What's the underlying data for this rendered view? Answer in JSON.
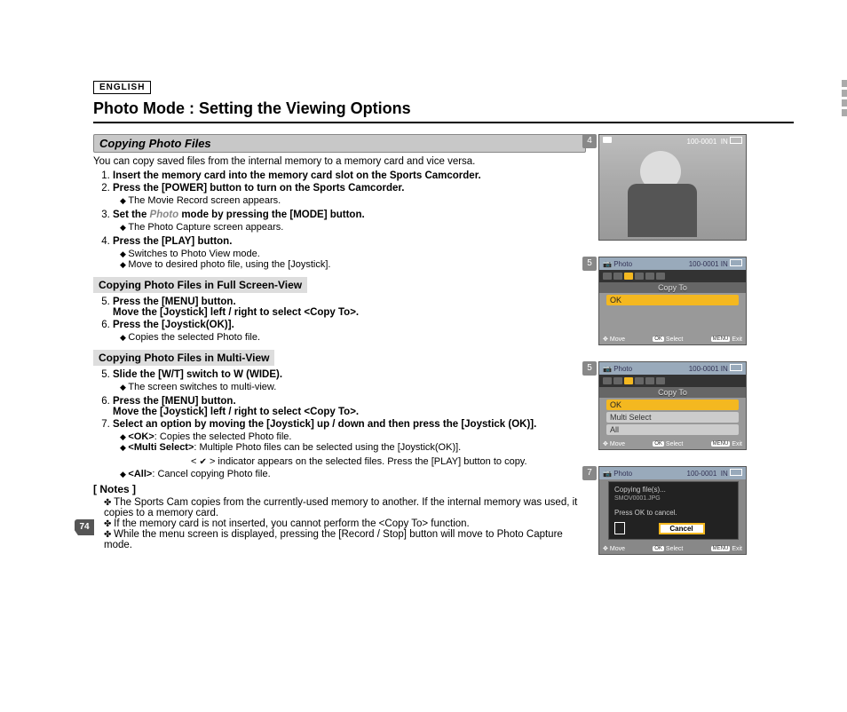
{
  "language": "ENGLISH",
  "page_title": "Photo Mode : Setting the Viewing Options",
  "section_header": "Copying Photo Files",
  "intro": "You can copy saved files from the internal memory to a memory card and vice versa.",
  "steps_a": [
    {
      "title": "Insert the memory card into the memory card slot on the Sports Camcorder."
    },
    {
      "title": "Press the [POWER] button to turn on the Sports Camcorder.",
      "bullets": [
        "The Movie Record screen appears."
      ]
    },
    {
      "title_pre": "Set the ",
      "title_gray": "Photo",
      "title_post": " mode by pressing the [MODE] button.",
      "bullets": [
        "The Photo Capture screen appears."
      ]
    },
    {
      "title": "Press the [PLAY] button.",
      "bullets": [
        "Switches to Photo View mode.",
        "Move to desired photo file, using the [Joystick]."
      ]
    }
  ],
  "sub_header_full": "Copying Photo Files in Full Screen-View",
  "steps_b": [
    {
      "num": "5.",
      "title": "Press the [MENU] button.",
      "sub": "Move the [Joystick] left / right to select <Copy To>."
    },
    {
      "num": "6.",
      "title": "Press the [Joystick(OK)].",
      "bullets": [
        "Copies the selected Photo file."
      ]
    }
  ],
  "sub_header_multi": "Copying Photo Files in Multi-View",
  "steps_c": [
    {
      "num": "5.",
      "title": "Slide the [W/T] switch to W (WIDE).",
      "bullets": [
        "The screen switches to multi-view."
      ]
    },
    {
      "num": "6.",
      "title": "Press the [MENU] button.",
      "sub": "Move the [Joystick] left / right to select <Copy To>."
    },
    {
      "num": "7.",
      "title": "Select an option by moving the [Joystick] up / down and then press the [Joystick (OK)]."
    }
  ],
  "options": {
    "ok": {
      "label": "<OK>",
      "desc": ": Copies the selected Photo file."
    },
    "multi": {
      "label": "<Multi Select>",
      "desc": ": Multiple Photo files can be selected using the [Joystick(OK)]."
    },
    "multi_line2": "> indicator appears on the selected files. Press the [PLAY] button to copy.",
    "all": {
      "label": "<All>",
      "desc": ": Cancel copying Photo file."
    }
  },
  "notes_title": "[ Notes ]",
  "notes": [
    "The Sports Cam copies from the currently-used memory to another. If the internal memory was used, it copies to a memory card.",
    "If the memory card is not inserted, you cannot perform the <Copy To> function.",
    "While the menu screen is displayed, pressing the [Record / Stop] button will move to Photo Capture mode."
  ],
  "page_number": "74",
  "lcd": {
    "photo_label": "Photo",
    "counter": "100-0001",
    "copy_to": "Copy To",
    "ok": "OK",
    "multi_select": "Multi Select",
    "all": "All",
    "move": "Move",
    "select": "Select",
    "exit": "Exit",
    "ok_key": "OK",
    "menu_key": "MENU",
    "copying": "Copying file(s)...",
    "filename": "SMOV0001.JPG",
    "press_ok": "Press OK to cancel.",
    "cancel": "Cancel"
  },
  "badges": [
    "4",
    "5",
    "5",
    "7"
  ]
}
